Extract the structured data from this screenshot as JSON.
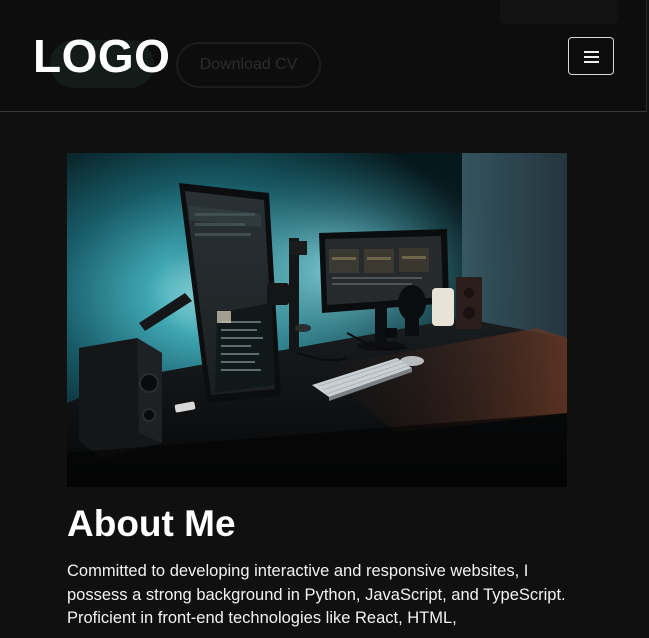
{
  "header": {
    "logo_text": "LOGO",
    "ghost_button_label": "Download CV",
    "menu_icon": "hamburger-icon"
  },
  "hero": {
    "image_icon": "desk-setup-photo"
  },
  "about": {
    "title": "About Me",
    "text": "Committed to developing interactive and responsive websites, I possess a strong background in Python, JavaScript, and TypeScript. Proficient in front-end technologies like React, HTML,"
  },
  "colors": {
    "background": "#101010",
    "header_background": "#0d0d0d",
    "text": "#ffffff",
    "accent_teal": "#2f8d9a"
  }
}
